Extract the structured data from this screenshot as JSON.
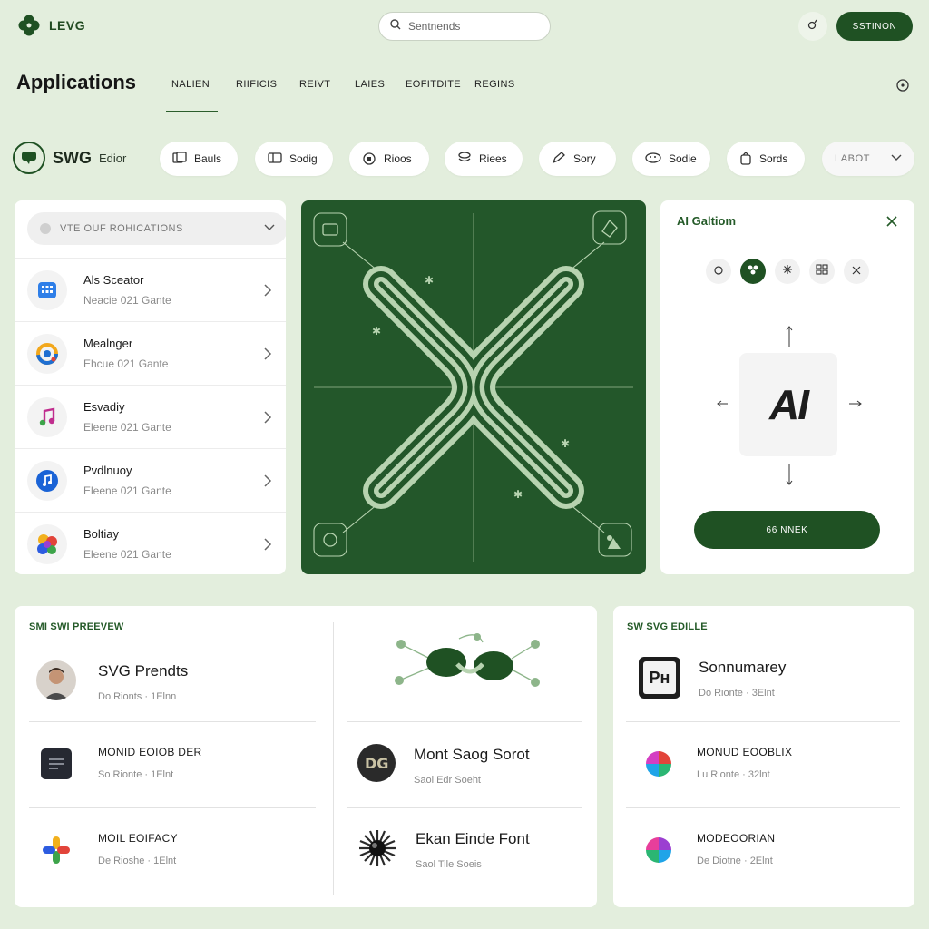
{
  "brand": {
    "name": "LEVG"
  },
  "search": {
    "placeholder": "Sentnends"
  },
  "topbar": {
    "cta_label": "SSTINON"
  },
  "page": {
    "title": "Applications"
  },
  "nav": {
    "tabs": [
      "NALIEN",
      "RIIFICIS",
      "REIVT",
      "LAIES",
      "EOFITDITE",
      "REGINS"
    ]
  },
  "brand_chip": {
    "big": "SWG",
    "small": "Edior"
  },
  "chips": [
    {
      "label": "Bauls",
      "icon": "gallery-icon"
    },
    {
      "label": "Sodig",
      "icon": "folder-icon"
    },
    {
      "label": "Rioos",
      "icon": "lock-icon"
    },
    {
      "label": "Riees",
      "icon": "stack-icon"
    },
    {
      "label": "Sory",
      "icon": "pencil-icon"
    },
    {
      "label": "Sodie",
      "icon": "palette-icon"
    },
    {
      "label": "Sords",
      "icon": "bag-icon"
    }
  ],
  "chip_select": {
    "label": "LABOT"
  },
  "list": {
    "filter_label": "VTE   OUF ROHICATIONS",
    "items": [
      {
        "title": "Als Sceator",
        "sub": "Neacie   021 Gante",
        "icon": "grid-app-icon"
      },
      {
        "title": "Mealnger",
        "sub": "Ehcue   021 Gante",
        "icon": "ring-app-icon"
      },
      {
        "title": "Esvadiy",
        "sub": "Eleene   021 Gante",
        "icon": "music-note-icon"
      },
      {
        "title": "Pvdlnuoy",
        "sub": "Eleene   021 Gante",
        "icon": "music-circle-icon"
      },
      {
        "title": "Boltiay",
        "sub": "Eleene   021 Gante",
        "icon": "blob-app-icon"
      }
    ]
  },
  "ai_panel": {
    "title": "AI Galtiom",
    "tile_text": "AI",
    "cta_label": "66 NNEK"
  },
  "preview": {
    "section_title": "SMI SWI PREEVEW",
    "left_rows": [
      {
        "title": "SVG Prendts",
        "sub": "Do Rionts  ·  1Elnn",
        "style": "lg",
        "icon": "avatar"
      },
      {
        "title": "MONID EOIOB DER",
        "sub": "So Rionte  ·  1Elnt",
        "style": "sm",
        "icon": "document-icon"
      },
      {
        "title": "MOIL EOIFACY",
        "sub": "De Rioshe  ·  1Elnt",
        "style": "sm",
        "icon": "plus-color-icon"
      }
    ],
    "right_rows": [
      {
        "title": "Mont Saog Sorot",
        "sub": "Saol Edr Soeht",
        "icon": "font-badge-icon"
      },
      {
        "title": "Ekan Einde Font",
        "sub": "Saol Tile Soeis",
        "icon": "starburst-icon"
      }
    ]
  },
  "editor": {
    "section_title": "SW SVG EDILLE",
    "rows": [
      {
        "title": "Sonnumarey",
        "sub": "Do Rionte  ·  3Elnt",
        "style": "lg",
        "icon": "app-tile-icon",
        "tile_text": "Pн"
      },
      {
        "title": "MONUD EOOBLIX",
        "sub": "Lu Rionte  ·  32lnt",
        "style": "sm",
        "icon": "color-wheel-icon"
      },
      {
        "title": "MODEOORIAN",
        "sub": "De Diotne  ·  2Elnt",
        "style": "sm",
        "icon": "color-wheel-icon"
      }
    ]
  },
  "colors": {
    "accent": "#1f5123",
    "canvas": "#23572a",
    "stroke": "#b7d3b0",
    "bg": "#e3eedd"
  }
}
